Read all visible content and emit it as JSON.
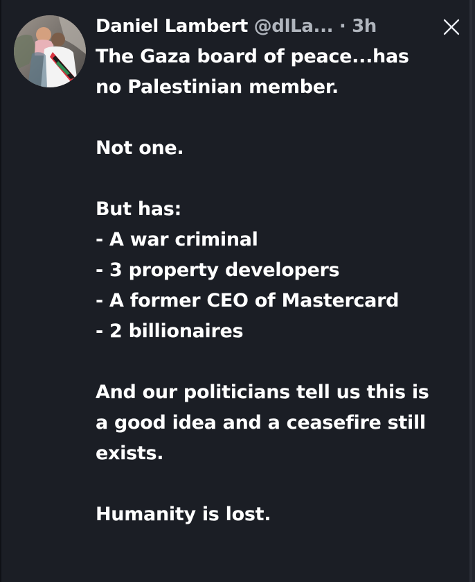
{
  "tweet": {
    "author_name": "Daniel Lambert",
    "author_handle": "@dlLa...",
    "separator": "·",
    "timestamp": "3h",
    "lines": {
      "line1": "The Gaza board of peace...has",
      "line2": "no Palestinian member.",
      "line3": "Not one.",
      "line4": "But has:",
      "list_items": [
        "- A war criminal",
        "- 3 property developers",
        "- A former CEO of Mastercard",
        "- 2 billionaires"
      ],
      "line5": "And our politicians tell us this is",
      "line6": "a good idea and a ceasefire still",
      "line7": "exists.",
      "line8": "Humanity is lost."
    }
  },
  "icons": {
    "avatar": "avatar-photo",
    "close": "close-icon"
  },
  "colors": {
    "background": "#1b1e25",
    "text": "#ffffff",
    "muted_text": "#b0b5bd"
  }
}
